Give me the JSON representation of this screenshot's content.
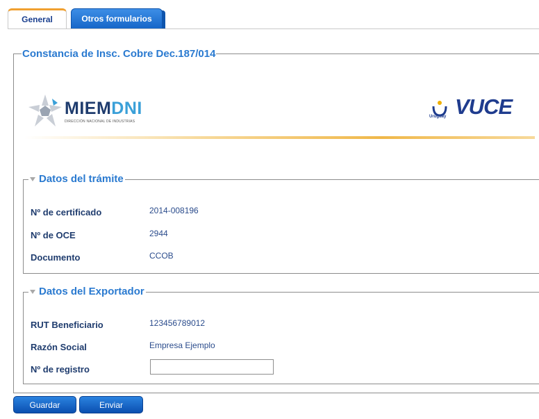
{
  "tabs": [
    {
      "label": "General",
      "active": true
    },
    {
      "label": "Otros formularios",
      "active": false
    }
  ],
  "form": {
    "title": "Constancia de Insc. Cobre Dec.187/014"
  },
  "logos": {
    "miem_main": "MIEM",
    "miem_accent": "DNI",
    "miem_sub": "DIRECCIÓN NACIONAL DE INDUSTRIAS",
    "uy_label": "Uruguay",
    "vuce": "VUCE"
  },
  "tramite": {
    "legend": "Datos del trámite",
    "fields": [
      {
        "label": "Nº de certificado",
        "value": "2014-008196"
      },
      {
        "label": "Nº de OCE",
        "value": "2944"
      },
      {
        "label": "Documento",
        "value": "CCOB"
      }
    ]
  },
  "exportador": {
    "legend": "Datos del Exportador",
    "fields": [
      {
        "label": "RUT Beneficiario",
        "value": "123456789012"
      },
      {
        "label": "Razón Social",
        "value": "Empresa Ejemplo"
      },
      {
        "label": "Nº de registro",
        "value": ""
      }
    ]
  },
  "buttons": {
    "guardar": "Guardar",
    "enviar": "Enviar"
  },
  "colors": {
    "accent_blue": "#2a7ad0",
    "label_navy": "#1f3c6e",
    "tab_orange": "#f0a030",
    "button_blue": "#1666c8"
  }
}
